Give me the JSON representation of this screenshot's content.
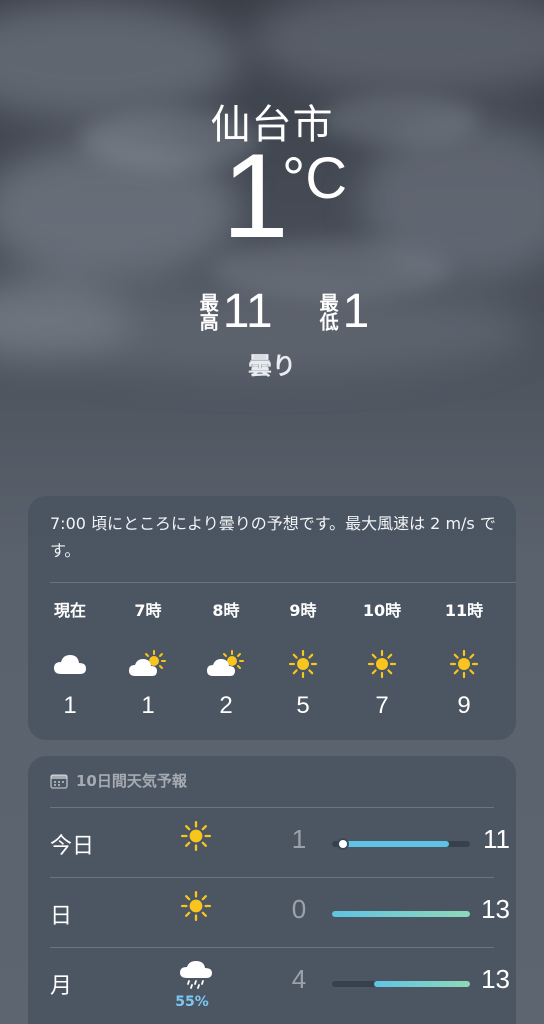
{
  "current": {
    "city": "仙台市",
    "temp": "1",
    "unit": "°C",
    "high_label": "最高",
    "high": "11",
    "low_label": "最低",
    "low": "1",
    "condition": "曇り"
  },
  "hourly": {
    "summary": "7:00 頃にところにより曇りの予想です。最大風速は 2 m/s です。",
    "items": [
      {
        "label": "現在",
        "icon": "cloud-icon",
        "temp": "1"
      },
      {
        "label": "7時",
        "icon": "partly-sunny-icon",
        "temp": "1"
      },
      {
        "label": "8時",
        "icon": "partly-sunny-icon",
        "temp": "2"
      },
      {
        "label": "9時",
        "icon": "sun-icon",
        "temp": "5"
      },
      {
        "label": "10時",
        "icon": "sun-icon",
        "temp": "7"
      },
      {
        "label": "11時",
        "icon": "sun-icon",
        "temp": "9"
      }
    ]
  },
  "daily": {
    "title": "10日間天気予報",
    "scale_min": 0,
    "scale_max": 13,
    "items": [
      {
        "day": "今日",
        "icon": "sun-icon",
        "precip": "",
        "low": "1",
        "high": "11",
        "current": 1
      },
      {
        "day": "日",
        "icon": "sun-icon",
        "precip": "",
        "low": "0",
        "high": "13"
      },
      {
        "day": "月",
        "icon": "rain-cloud-icon",
        "precip": "55%",
        "low": "4",
        "high": "13"
      }
    ]
  },
  "colors": {
    "sun": "#f7c51e",
    "bar_cool": "#5fc3e4",
    "bar_warm": "#8fd9b8",
    "precip": "#7cc8f3"
  }
}
